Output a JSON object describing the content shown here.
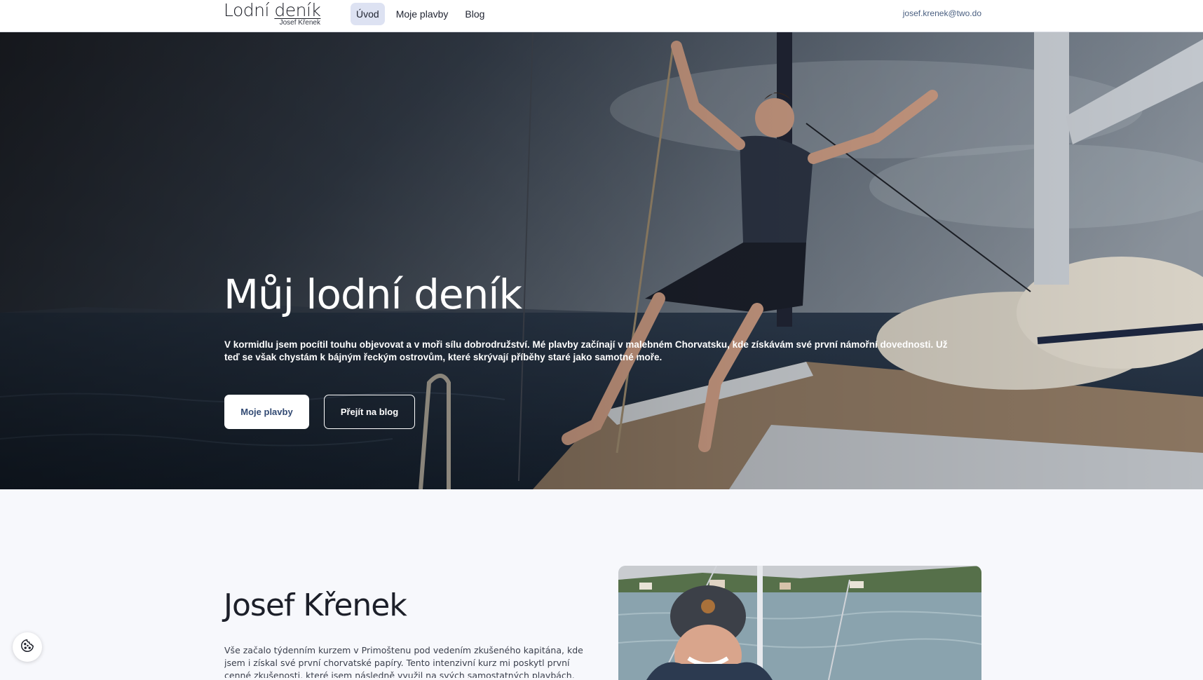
{
  "header": {
    "logo_title_plain": "Lodní ",
    "logo_title_underlined": "deník",
    "logo_subtitle": "Josef Křenek",
    "nav": [
      {
        "label": "Úvod",
        "active": true
      },
      {
        "label": "Moje plavby",
        "active": false
      },
      {
        "label": "Blog",
        "active": false
      }
    ],
    "email": "josef.krenek@two.do"
  },
  "hero": {
    "title": "Můj lodní deník",
    "text": "V kormidlu jsem pocítil touhu objevovat a v moři sílu dobrodružství. Mé plavby začínají v malebném Chorvatsku, kde získávám své první námořní dovednosti. Už teď se však chystám k bájným řeckým ostrovům, které skrývají příběhy staré jako samotné moře.",
    "primary_button": "Moje plavby",
    "secondary_button": "Přejít na blog"
  },
  "about": {
    "name": "Josef Křenek",
    "text": "Vše začalo týdenním kurzem v Primoštenu pod vedením zkušeného kapitána, kde jsem i získal své první chorvatské papíry. Tento intenzivní kurz mi poskytl první cenné zkušenosti, které jsem následně využil na svých samostatných plavbách. První z nich"
  },
  "colors": {
    "accent": "#324a73",
    "nav_active_bg": "#dde2f2",
    "page_bg": "#f7f8fc"
  },
  "icons": {
    "cookie_button": "cookie-icon"
  }
}
